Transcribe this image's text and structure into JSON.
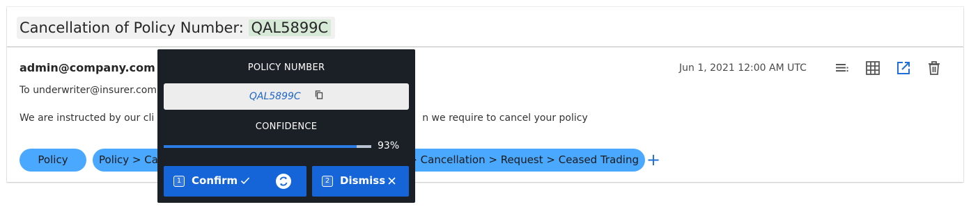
{
  "title": {
    "prefix": "Cancellation of Policy Number:",
    "highlight": "QAL5899C"
  },
  "email": {
    "sender": "admin@company.com",
    "recipient": "To underwriter@insurer.com",
    "body_start": "We are instructed by our cli",
    "body_end": "n we require to cancel your policy",
    "timestamp": "Jun 1, 2021 12:00 AM UTC"
  },
  "toolbar": {
    "icons": [
      "text-lines-icon",
      "table-grid-icon",
      "open-external-icon",
      "delete-icon"
    ],
    "accent_color": "#1e6fd9"
  },
  "tags": [
    {
      "label_start": "Policy",
      "label_end": ""
    },
    {
      "label_start": "Policy > Can",
      "label_end": "cy > Cancellation > Request > Ceased Trading"
    }
  ],
  "tag_color": "#4aa8ff",
  "add_tag_symbol": "+",
  "popup": {
    "field_label": "POLICY NUMBER",
    "field_value": "QAL5899C",
    "confidence_label": "CONFIDENCE",
    "confidence_value": 93,
    "confidence_text": "93%",
    "confirm": {
      "shortcut": "1",
      "label": "Confirm"
    },
    "dismiss": {
      "shortcut": "2",
      "label": "Dismiss"
    },
    "button_color": "#1565d8",
    "background_color": "#1b2027"
  }
}
